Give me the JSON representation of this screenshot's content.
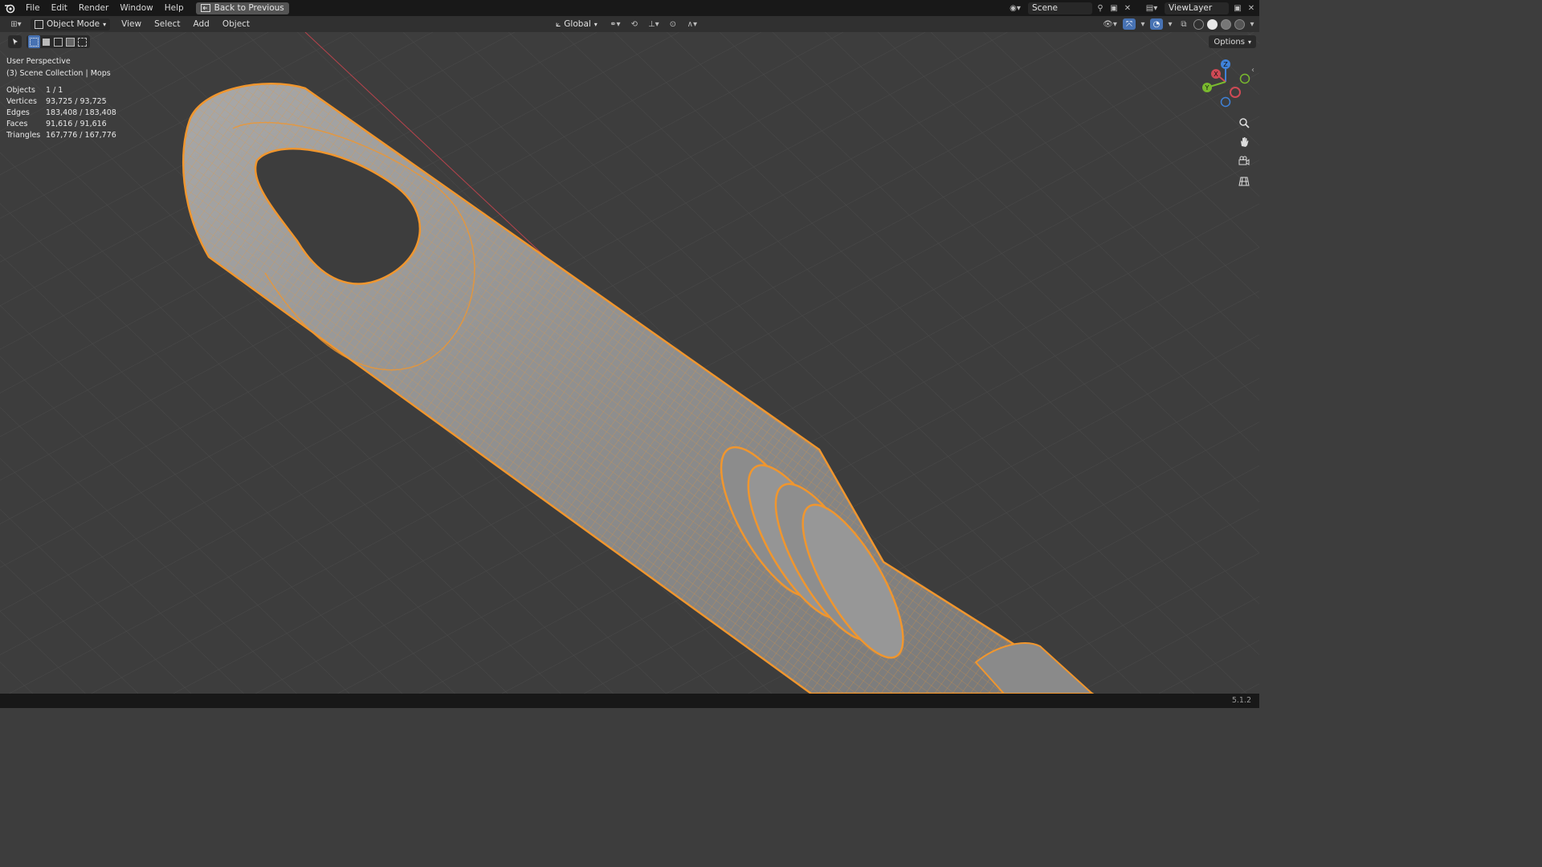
{
  "topbar": {
    "menus": [
      "File",
      "Edit",
      "Render",
      "Window",
      "Help"
    ],
    "back_button": "Back to Previous",
    "scene_name": "Scene",
    "view_layer": "ViewLayer"
  },
  "header": {
    "mode": "Object Mode",
    "menus": [
      "View",
      "Select",
      "Add",
      "Object"
    ],
    "transform_orientation": "Global"
  },
  "toolbar": {
    "options_label": "Options"
  },
  "viewport": {
    "perspective_label": "User Perspective",
    "collection_label": "(3) Scene Collection | Mops",
    "stats": [
      {
        "label": "Objects",
        "value": "1 / 1"
      },
      {
        "label": "Vertices",
        "value": "93,725 / 93,725"
      },
      {
        "label": "Edges",
        "value": "183,408 / 183,408"
      },
      {
        "label": "Faces",
        "value": "91,616 / 91,616"
      },
      {
        "label": "Triangles",
        "value": "167,776 / 167,776"
      }
    ],
    "gizmo": {
      "x": "X",
      "y": "Y",
      "z": "Z"
    },
    "colors": {
      "background": "#3d3d3d",
      "selection_outline": "#f0962e",
      "mesh_fill": "#9a9a9a",
      "x_axis": "#cf4a55",
      "y_axis": "#7aba2e",
      "z_axis": "#3f82d9"
    }
  },
  "status": {
    "version": "5.1.2"
  }
}
